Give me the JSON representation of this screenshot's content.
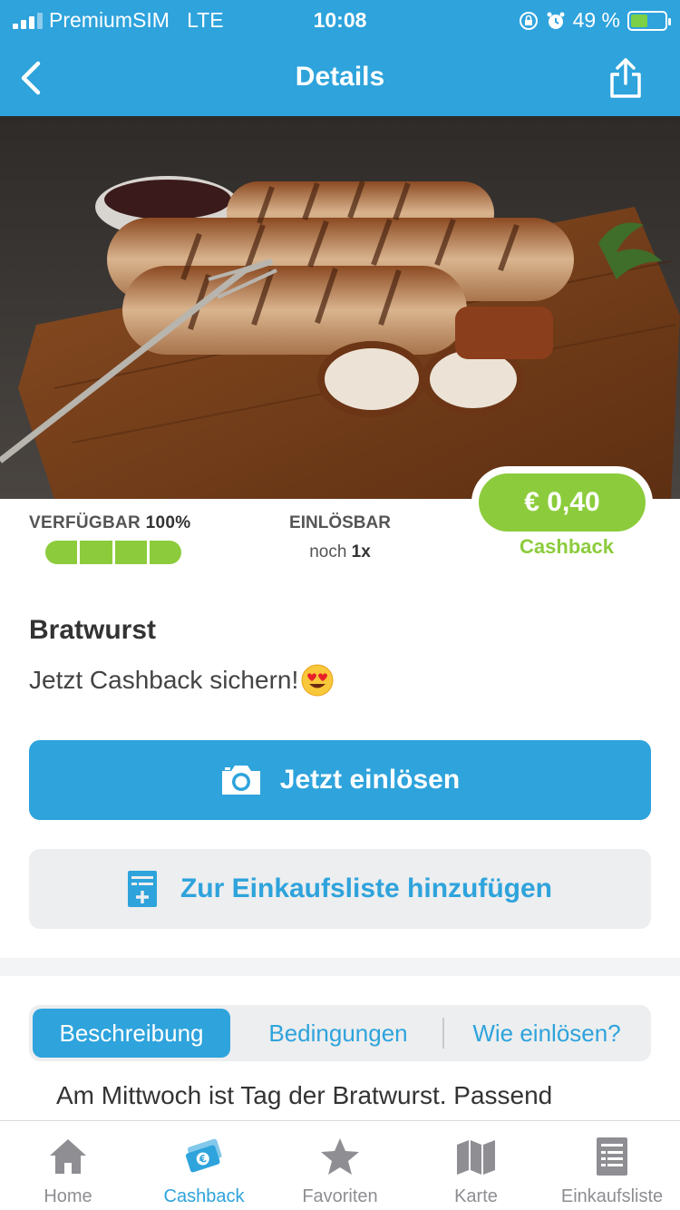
{
  "status_bar": {
    "carrier": "PremiumSIM",
    "network": "LTE",
    "time": "10:08",
    "battery": "49 %",
    "battery_level": 0.49
  },
  "nav": {
    "title": "Details",
    "back_icon": "chevron-left-icon",
    "share_icon": "share-icon"
  },
  "offer": {
    "availability_label": "VERFÜGBAR",
    "availability_value": "100%",
    "availability_level": 1.0,
    "redeemable_label": "EINLÖSBAR",
    "redeemable_prefix": "noch",
    "redeemable_count": "1x",
    "price": "€ 0,40",
    "price_caption": "Cashback"
  },
  "product": {
    "name": "Bratwurst",
    "subtitle": "Jetzt Cashback sichern!"
  },
  "actions": {
    "redeem_label": "Jetzt einlösen",
    "add_to_list_label": "Zur Einkaufsliste hinzufügen"
  },
  "tabs": [
    "Beschreibung",
    "Bedingungen",
    "Wie einlösen?"
  ],
  "description": "Am Mittwoch ist Tag der Bratwurst. Passend",
  "tabbar": [
    {
      "label": "Home",
      "icon": "home-icon"
    },
    {
      "label": "Cashback",
      "icon": "cashback-icon"
    },
    {
      "label": "Favoriten",
      "icon": "star-icon"
    },
    {
      "label": "Karte",
      "icon": "map-icon"
    },
    {
      "label": "Einkaufsliste",
      "icon": "list-icon"
    }
  ],
  "colors": {
    "primary": "#2ea3dc",
    "accent_green": "#8ccc3c",
    "secondary_bg": "#eceeef"
  }
}
